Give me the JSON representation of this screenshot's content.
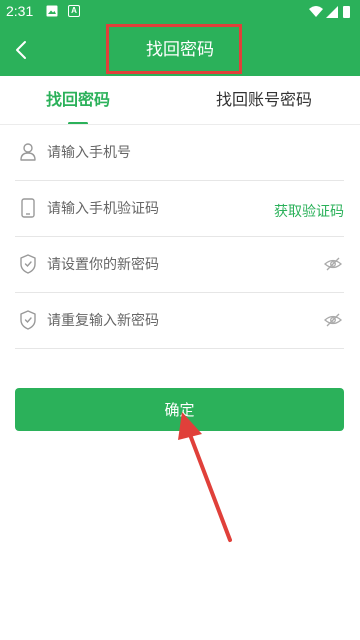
{
  "status_bar": {
    "time": "2:31",
    "indicator_text": "A"
  },
  "app_bar": {
    "title": "找回密码"
  },
  "tabs": [
    {
      "label": "找回密码",
      "active": true
    },
    {
      "label": "找回账号密码",
      "active": false
    }
  ],
  "form": {
    "phone": {
      "value": "",
      "placeholder": "请输入手机号"
    },
    "code": {
      "value": "",
      "placeholder": "请输入手机验证码",
      "action_label": "获取验证码"
    },
    "new_password": {
      "value": "",
      "placeholder": "请设置你的新密码"
    },
    "repeat_password": {
      "value": "",
      "placeholder": "请重复输入新密码"
    }
  },
  "confirm_label": "确定",
  "icons": {
    "back": "chevron-left-icon",
    "phone": "person-icon",
    "code": "phone-device-icon",
    "password": "shield-icon",
    "visibility": "eye-off-icon"
  },
  "colors": {
    "brand": "#2bb15a",
    "annotation": "#e0403a"
  }
}
